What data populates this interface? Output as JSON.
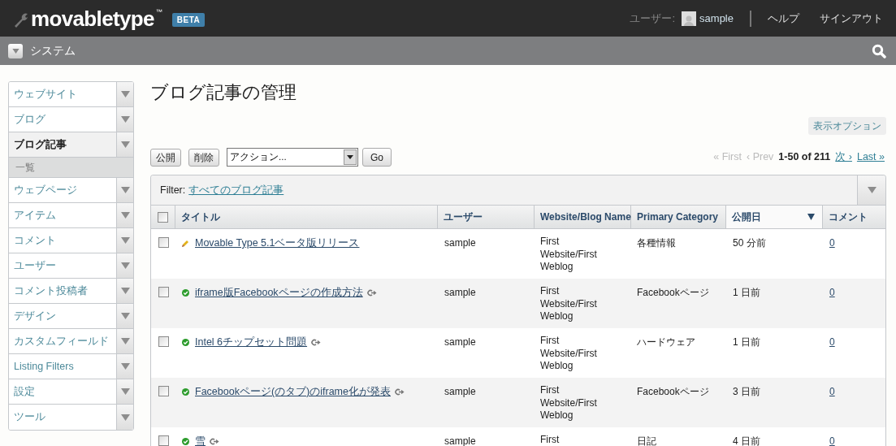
{
  "header": {
    "logo": "movabletype",
    "trademark": "™",
    "badge": "BETA",
    "user_label": "ユーザー:",
    "user_name": "sample",
    "links": [
      "ヘルプ",
      "サインアウト"
    ]
  },
  "scope_bar": {
    "label": "システム"
  },
  "sidebar": {
    "items": [
      {
        "label": "ウェブサイト",
        "selected": false
      },
      {
        "label": "ブログ",
        "selected": false
      },
      {
        "label": "ブログ記事",
        "selected": true,
        "children": [
          {
            "label": "一覧"
          }
        ]
      },
      {
        "label": "ウェブページ",
        "selected": false
      },
      {
        "label": "アイテム",
        "selected": false
      },
      {
        "label": "コメント",
        "selected": false
      },
      {
        "label": "ユーザー",
        "selected": false
      },
      {
        "label": "コメント投稿者",
        "selected": false
      },
      {
        "label": "デザイン",
        "selected": false
      },
      {
        "label": "カスタムフィールド",
        "selected": false
      },
      {
        "label": "Listing Filters",
        "selected": false
      },
      {
        "label": "設定",
        "selected": false
      },
      {
        "label": "ツール",
        "selected": false
      }
    ]
  },
  "page_title": "ブログ記事の管理",
  "display_options": "表示オプション",
  "toolbar": {
    "buttons": [
      "公開",
      "削除"
    ],
    "action_select": "アクション...",
    "go": "Go"
  },
  "pagination": [
    {
      "label": "« First",
      "kind": "link",
      "disabled": true
    },
    {
      "label": "‹ Prev",
      "kind": "link",
      "disabled": true
    },
    {
      "label": "1-50 of 211",
      "kind": "range"
    },
    {
      "label": "次 ›",
      "kind": "link",
      "disabled": false
    },
    {
      "label": "Last »",
      "kind": "link",
      "disabled": false
    }
  ],
  "filter": {
    "label": "Filter:",
    "value": "すべてのブログ記事"
  },
  "table": {
    "select_all": {
      "checked": false
    },
    "columns": [
      {
        "label": "タイトル",
        "sorted": false
      },
      {
        "label": "ユーザー",
        "sorted": false
      },
      {
        "label": "Website/Blog Name",
        "sorted": false
      },
      {
        "label": "Primary Category",
        "sorted": false
      },
      {
        "label": "公開日",
        "sorted": true
      },
      {
        "label": "コメント",
        "sorted": false
      }
    ],
    "rows": [
      {
        "checked": false,
        "draft": true,
        "title": "Movable Type 5.1ベータ版リリース",
        "user": "sample",
        "website": [
          "First",
          "Website/First",
          "Weblog"
        ],
        "category": "各種情報",
        "date": "50 分前",
        "comments": "0"
      },
      {
        "checked": false,
        "draft": false,
        "title": "iframe版Facebookページの作成方法",
        "user": "sample",
        "website": [
          "First",
          "Website/First",
          "Weblog"
        ],
        "category": "Facebookページ",
        "date": "1 日前",
        "comments": "0"
      },
      {
        "checked": false,
        "draft": false,
        "title": "Intel 6チップセット問題",
        "user": "sample",
        "website": [
          "First",
          "Website/First",
          "Weblog"
        ],
        "category": "ハードウェア",
        "date": "1 日前",
        "comments": "0"
      },
      {
        "checked": false,
        "draft": false,
        "title": "Facebookページ(のタブ)のiframe化が発表",
        "user": "sample",
        "website": [
          "First",
          "Website/First",
          "Weblog"
        ],
        "category": "Facebookページ",
        "date": "3 日前",
        "comments": "0"
      },
      {
        "checked": false,
        "draft": false,
        "title": "雪",
        "user": "sample",
        "website": [
          "First"
        ],
        "category": "日記",
        "date": "4 日前",
        "comments": "0"
      }
    ]
  }
}
